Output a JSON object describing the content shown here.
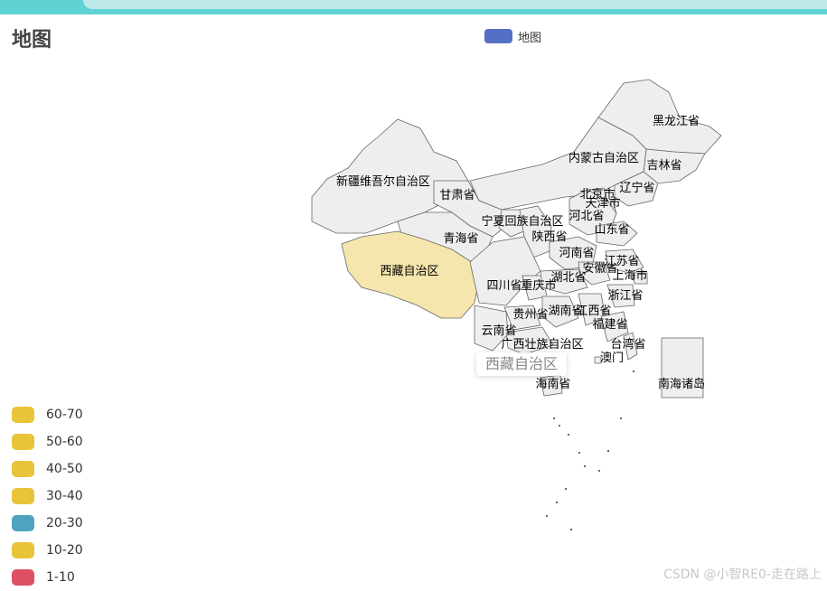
{
  "title": "地图",
  "legend": {
    "label": "地图",
    "color": "#5470c6"
  },
  "colors": {
    "region_default": "#eeeeee",
    "region_border": "#666666",
    "highlight": "#f5e6ad"
  },
  "map": {
    "highlighted_region": "西藏自治区",
    "regions": [
      "黑龙江省",
      "吉林省",
      "内蒙古自治区",
      "辽宁省",
      "新疆维吾尔自治区",
      "甘肃省",
      "北京市",
      "天津市",
      "宁夏回族自治区",
      "河北省",
      "青海省",
      "陕西省",
      "山东省",
      "河南省",
      "江苏省",
      "安徽省",
      "上海市",
      "西藏自治区",
      "四川省",
      "重庆市",
      "湖北省",
      "浙江省",
      "湖南省",
      "江西省",
      "贵州省",
      "福建省",
      "云南省",
      "广西壮族自治区",
      "台湾省",
      "澳门",
      "海南省",
      "南海诸岛"
    ]
  },
  "tooltip": {
    "text": "西藏自治区"
  },
  "visual_map": {
    "pieces": [
      {
        "label": "60-70",
        "color": "#e8c43a"
      },
      {
        "label": "50-60",
        "color": "#e8c43a"
      },
      {
        "label": "40-50",
        "color": "#e8c43a"
      },
      {
        "label": "30-40",
        "color": "#e8c43a"
      },
      {
        "label": "20-30",
        "color": "#4fa3be"
      },
      {
        "label": "10-20",
        "color": "#e8c43a"
      },
      {
        "label": "1-10",
        "color": "#dd5064"
      }
    ]
  },
  "watermark": "CSDN @小智RE0-走在路上"
}
